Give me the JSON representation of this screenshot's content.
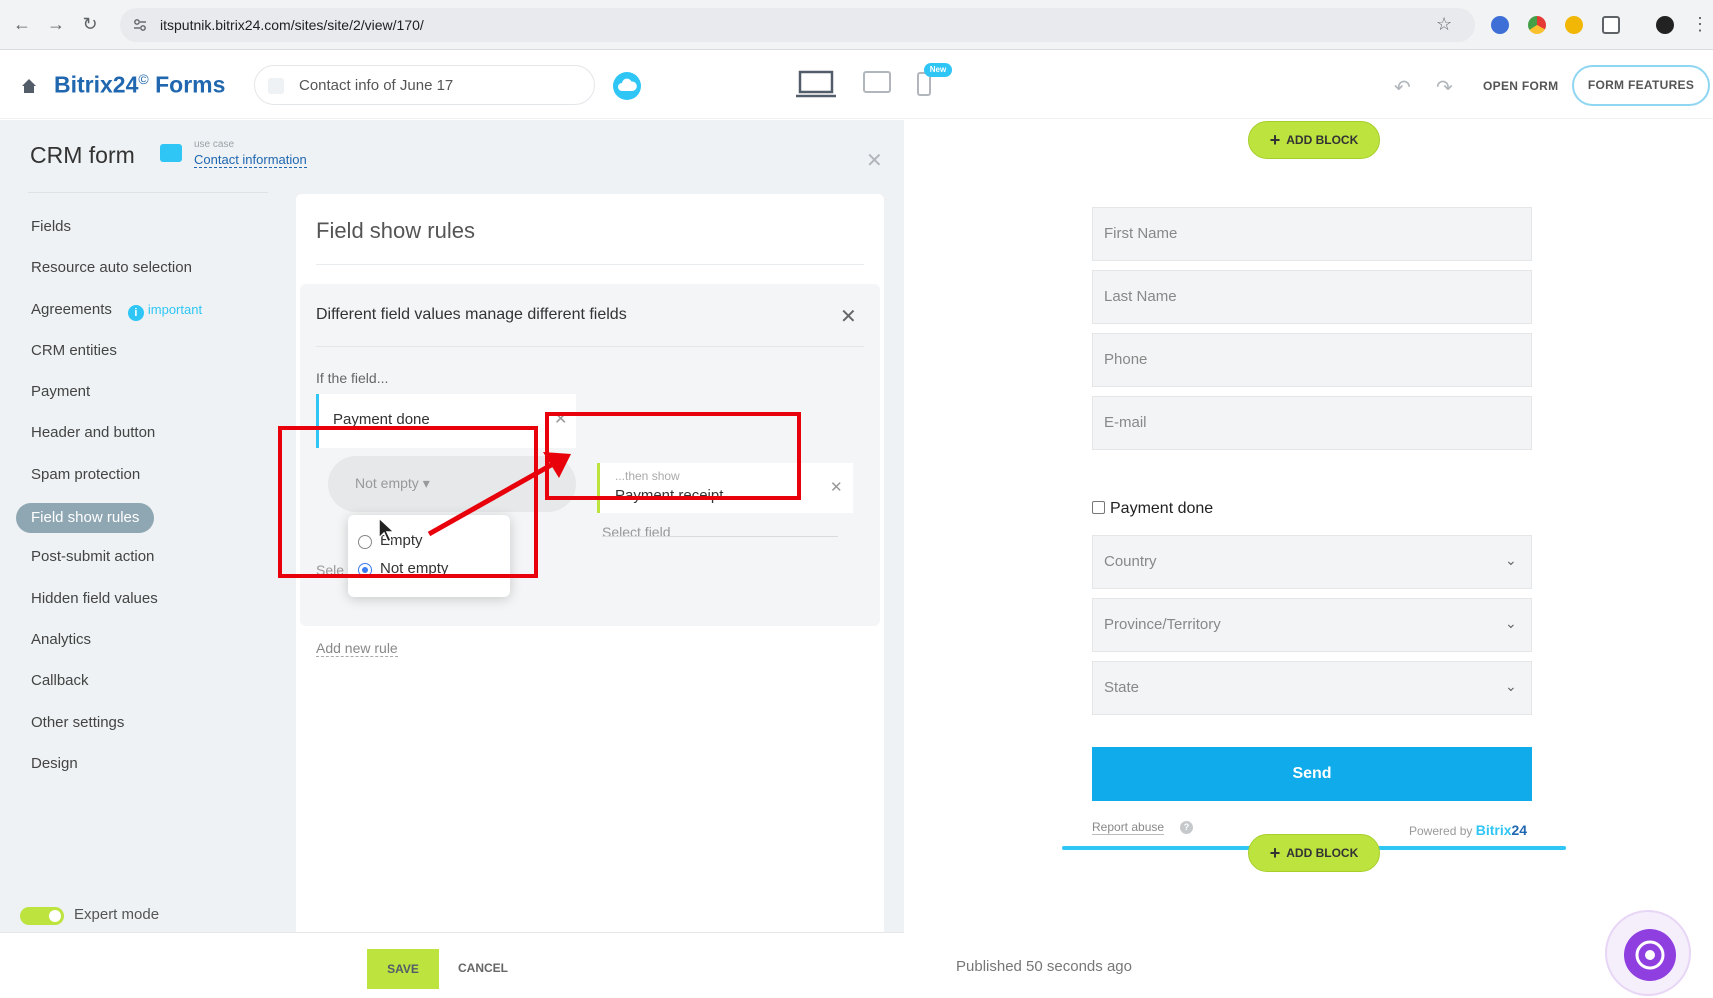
{
  "browser": {
    "url": "itsputnik.bitrix24.com/sites/site/2/view/170/",
    "back_icon": "arrow-left-icon",
    "forward_icon": "arrow-right-icon",
    "reload_icon": "reload-icon",
    "star_icon": "star-icon"
  },
  "app": {
    "logo_brand": "Bitrix24",
    "logo_mark": "©",
    "logo_product": "Forms",
    "form_title": "Contact info of June 17",
    "new_badge": "New",
    "open_form": "OPEN FORM",
    "form_features": "FORM FEATURES"
  },
  "left": {
    "crm_title": "CRM form",
    "use_case_label": "use case",
    "use_case_value": "Contact information",
    "menu": [
      {
        "label": "Fields"
      },
      {
        "label": "Resource auto selection"
      },
      {
        "label": "Agreements",
        "badge": "important"
      },
      {
        "label": "CRM entities"
      },
      {
        "label": "Payment"
      },
      {
        "label": "Header and button"
      },
      {
        "label": "Spam protection"
      },
      {
        "label": "Field show rules",
        "active": true
      },
      {
        "label": "Post-submit action"
      },
      {
        "label": "Hidden field values"
      },
      {
        "label": "Analytics"
      },
      {
        "label": "Callback"
      },
      {
        "label": "Other settings"
      },
      {
        "label": "Design"
      }
    ],
    "expert_mode": "Expert mode"
  },
  "panel": {
    "title": "Field show rules",
    "rule_title": "Different field values manage different fields",
    "if_label": "If the field...",
    "field_value": "Payment done",
    "condition": "Not empty ▾",
    "select_behind": "Sele",
    "options": [
      "Empty",
      "Not empty"
    ],
    "selected_option": "Not empty",
    "then_label": "...then show",
    "then_value": "Payment receipt",
    "select_field": "Select field",
    "add_rule": "Add new rule"
  },
  "footer": {
    "save": "SAVE",
    "cancel": "CANCEL"
  },
  "preview": {
    "add_block": "ADD BLOCK",
    "fields": [
      "First Name",
      "Last Name",
      "Phone",
      "E-mail"
    ],
    "checkbox": "Payment done",
    "selects": [
      "Country",
      "Province/Territory",
      "State"
    ],
    "send": "Send",
    "report": "Report abuse",
    "powered_prefix": "Powered by",
    "powered_brand": "Bitrix",
    "powered_num": "24",
    "published": "Published 50 seconds ago"
  },
  "colors": {
    "accent_blue": "#2fc6f6",
    "brand_navy": "#2067b0",
    "green_button": "#bde33f",
    "send_button": "#0fabea",
    "highlight_red": "#e8000b"
  }
}
